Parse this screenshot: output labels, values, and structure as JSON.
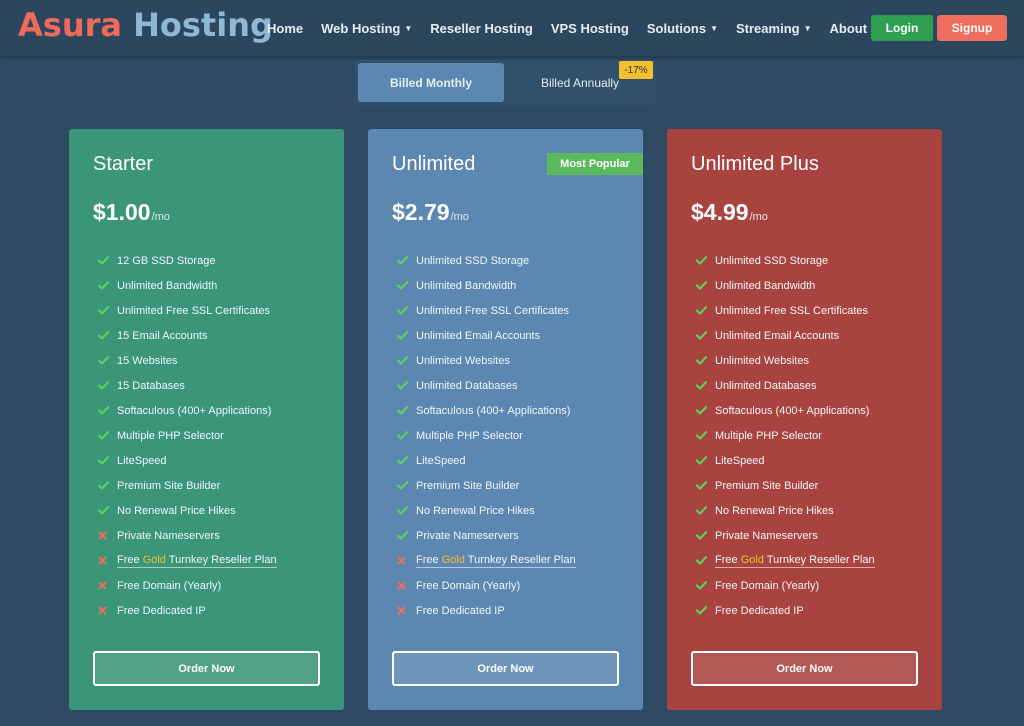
{
  "header": {
    "logo_part1": "Asura",
    "logo_part2": "Hosting",
    "nav": [
      {
        "label": "Home",
        "dropdown": false
      },
      {
        "label": "Web Hosting",
        "dropdown": true
      },
      {
        "label": "Reseller Hosting",
        "dropdown": false
      },
      {
        "label": "VPS Hosting",
        "dropdown": false
      },
      {
        "label": "Solutions",
        "dropdown": true
      },
      {
        "label": "Streaming",
        "dropdown": true
      },
      {
        "label": "About Us",
        "dropdown": false
      }
    ],
    "login_label": "Login",
    "signup_label": "Signup"
  },
  "billing": {
    "monthly_label": "Billed Monthly",
    "annual_label": "Billed Annually",
    "annual_discount": "-17%"
  },
  "colors": {
    "starter": "#3a9579",
    "unlimited": "#5b87b1",
    "unlimited_plus": "#a8433f",
    "check": "#5ecf5e",
    "cross": "#ee6d5c",
    "gold": "#f3c02f"
  },
  "plans": [
    {
      "name": "Starter",
      "price": "$1.00",
      "period": "/mo",
      "badge": "",
      "order_label": "Order Now",
      "features": [
        {
          "pre": "",
          "hl": "",
          "text": "12 GB SSD Storage",
          "included": true,
          "underline": false
        },
        {
          "pre": "",
          "hl": "",
          "text": "Unlimited Bandwidth",
          "included": true,
          "underline": false
        },
        {
          "pre": "",
          "hl": "",
          "text": "Unlimited Free SSL Certificates",
          "included": true,
          "underline": false
        },
        {
          "pre": "",
          "hl": "",
          "text": "15 Email Accounts",
          "included": true,
          "underline": false
        },
        {
          "pre": "",
          "hl": "",
          "text": "15 Websites",
          "included": true,
          "underline": false
        },
        {
          "pre": "",
          "hl": "",
          "text": "15 Databases",
          "included": true,
          "underline": false
        },
        {
          "pre": "",
          "hl": "",
          "text": "Softaculous (400+ Applications)",
          "included": true,
          "underline": false
        },
        {
          "pre": "",
          "hl": "",
          "text": "Multiple PHP Selector",
          "included": true,
          "underline": false
        },
        {
          "pre": "",
          "hl": "",
          "text": "LiteSpeed",
          "included": true,
          "underline": false
        },
        {
          "pre": "",
          "hl": "",
          "text": "Premium Site Builder",
          "included": true,
          "underline": false
        },
        {
          "pre": "",
          "hl": "",
          "text": "No Renewal Price Hikes",
          "included": true,
          "underline": false
        },
        {
          "pre": "",
          "hl": "",
          "text": "Private Nameservers",
          "included": false,
          "underline": false
        },
        {
          "pre": "Free ",
          "hl": "Gold",
          "text": " Turnkey Reseller Plan",
          "included": false,
          "underline": true
        },
        {
          "pre": "",
          "hl": "",
          "text": "Free Domain (Yearly)",
          "included": false,
          "underline": false
        },
        {
          "pre": "",
          "hl": "",
          "text": "Free Dedicated IP",
          "included": false,
          "underline": false
        }
      ]
    },
    {
      "name": "Unlimited",
      "price": "$2.79",
      "period": "/mo",
      "badge": "Most Popular",
      "order_label": "Order Now",
      "features": [
        {
          "pre": "",
          "hl": "",
          "text": "Unlimited SSD Storage",
          "included": true,
          "underline": false
        },
        {
          "pre": "",
          "hl": "",
          "text": "Unlimited Bandwidth",
          "included": true,
          "underline": false
        },
        {
          "pre": "",
          "hl": "",
          "text": "Unlimited Free SSL Certificates",
          "included": true,
          "underline": false
        },
        {
          "pre": "",
          "hl": "",
          "text": "Unlimited Email Accounts",
          "included": true,
          "underline": false
        },
        {
          "pre": "",
          "hl": "",
          "text": "Unlimited Websites",
          "included": true,
          "underline": false
        },
        {
          "pre": "",
          "hl": "",
          "text": "Unlimited Databases",
          "included": true,
          "underline": false
        },
        {
          "pre": "",
          "hl": "",
          "text": "Softaculous (400+ Applications)",
          "included": true,
          "underline": false
        },
        {
          "pre": "",
          "hl": "",
          "text": "Multiple PHP Selector",
          "included": true,
          "underline": false
        },
        {
          "pre": "",
          "hl": "",
          "text": "LiteSpeed",
          "included": true,
          "underline": false
        },
        {
          "pre": "",
          "hl": "",
          "text": "Premium Site Builder",
          "included": true,
          "underline": false
        },
        {
          "pre": "",
          "hl": "",
          "text": "No Renewal Price Hikes",
          "included": true,
          "underline": false
        },
        {
          "pre": "",
          "hl": "",
          "text": "Private Nameservers",
          "included": true,
          "underline": false
        },
        {
          "pre": "Free ",
          "hl": "Gold",
          "text": " Turnkey Reseller Plan",
          "included": false,
          "underline": true
        },
        {
          "pre": "",
          "hl": "",
          "text": "Free Domain (Yearly)",
          "included": false,
          "underline": false
        },
        {
          "pre": "",
          "hl": "",
          "text": "Free Dedicated IP",
          "included": false,
          "underline": false
        }
      ]
    },
    {
      "name": "Unlimited Plus",
      "price": "$4.99",
      "period": "/mo",
      "badge": "",
      "order_label": "Order Now",
      "features": [
        {
          "pre": "",
          "hl": "",
          "text": "Unlimited SSD Storage",
          "included": true,
          "underline": false
        },
        {
          "pre": "",
          "hl": "",
          "text": "Unlimited Bandwidth",
          "included": true,
          "underline": false
        },
        {
          "pre": "",
          "hl": "",
          "text": "Unlimited Free SSL Certificates",
          "included": true,
          "underline": false
        },
        {
          "pre": "",
          "hl": "",
          "text": "Unlimited Email Accounts",
          "included": true,
          "underline": false
        },
        {
          "pre": "",
          "hl": "",
          "text": "Unlimited Websites",
          "included": true,
          "underline": false
        },
        {
          "pre": "",
          "hl": "",
          "text": "Unlimited Databases",
          "included": true,
          "underline": false
        },
        {
          "pre": "",
          "hl": "",
          "text": "Softaculous (400+ Applications)",
          "included": true,
          "underline": false
        },
        {
          "pre": "",
          "hl": "",
          "text": "Multiple PHP Selector",
          "included": true,
          "underline": false
        },
        {
          "pre": "",
          "hl": "",
          "text": "LiteSpeed",
          "included": true,
          "underline": false
        },
        {
          "pre": "",
          "hl": "",
          "text": "Premium Site Builder",
          "included": true,
          "underline": false
        },
        {
          "pre": "",
          "hl": "",
          "text": "No Renewal Price Hikes",
          "included": true,
          "underline": false
        },
        {
          "pre": "",
          "hl": "",
          "text": "Private Nameservers",
          "included": true,
          "underline": false
        },
        {
          "pre": "Free ",
          "hl": "Gold",
          "text": " Turnkey Reseller Plan",
          "included": true,
          "underline": true
        },
        {
          "pre": "",
          "hl": "",
          "text": "Free Domain (Yearly)",
          "included": true,
          "underline": false
        },
        {
          "pre": "",
          "hl": "",
          "text": "Free Dedicated IP",
          "included": true,
          "underline": false
        }
      ]
    }
  ]
}
